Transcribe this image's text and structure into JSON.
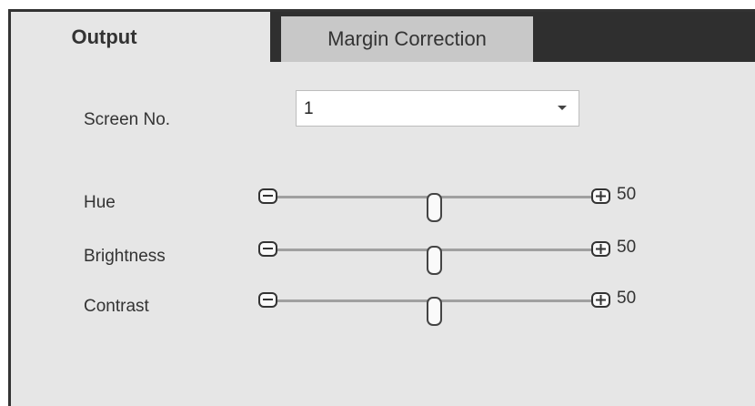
{
  "tabs": [
    {
      "label": "Output",
      "active": true
    },
    {
      "label": "Margin Correction",
      "active": false
    }
  ],
  "screen": {
    "label": "Screen No.",
    "value": "1"
  },
  "sliders": [
    {
      "label": "Hue",
      "value": "50",
      "level": 50
    },
    {
      "label": "Brightness",
      "value": "50",
      "level": 50
    },
    {
      "label": "Contrast",
      "value": "50",
      "level": 50
    }
  ],
  "colors": {
    "panel": "#e6e6e6",
    "tabbar": "#2f2f2f",
    "inactive_tab": "#c8c8c8",
    "text": "#333333"
  },
  "icons": [
    "minus-icon",
    "plus-icon",
    "chevron-down-icon"
  ]
}
